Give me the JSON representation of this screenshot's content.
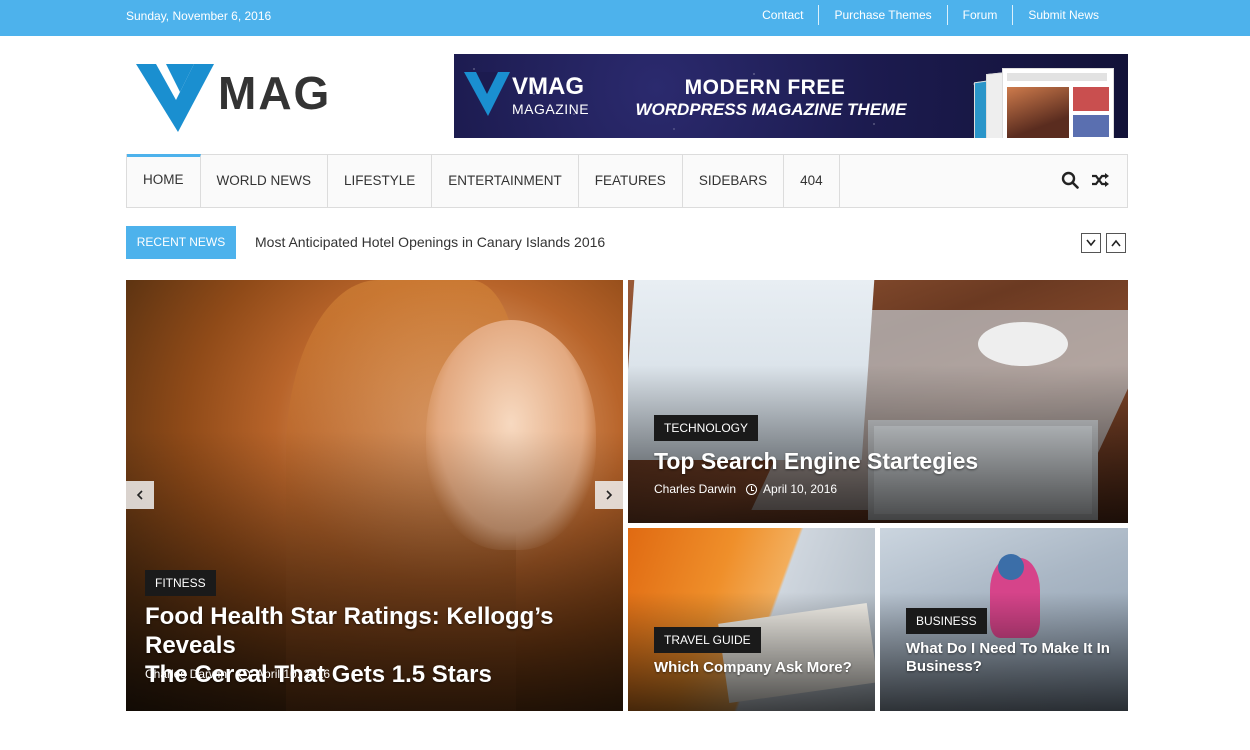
{
  "topbar": {
    "date": "Sunday, November 6, 2016",
    "links": [
      "Contact",
      "Purchase Themes",
      "Forum",
      "Submit News"
    ],
    "color": "#4db2ec"
  },
  "header": {
    "logo_text": "MAG",
    "banner": {
      "brand": "VMAG",
      "brand_sub": "MAGAZINE",
      "line1": "MODERN FREE",
      "line2": "WORDPRESS MAGAZINE THEME"
    }
  },
  "nav": {
    "items": [
      "HOME",
      "WORLD NEWS",
      "LIFESTYLE",
      "ENTERTAINMENT",
      "FEATURES",
      "SIDEBARS",
      "404"
    ],
    "active_index": 0,
    "tools": [
      "search-icon",
      "shuffle-icon"
    ]
  },
  "ticker": {
    "label": "RECENT NEWS",
    "headline": "Most Anticipated Hotel Openings in Canary Islands 2016"
  },
  "slider": {
    "category": "FITNESS",
    "title_line1": "Food Health Star Ratings: Kellogg’s Reveals",
    "title_line2": "The Cereal That Gets 1.5 Stars",
    "author": "Charles Darwin",
    "date": "April 10, 2016"
  },
  "featured": [
    {
      "category": "TECHNOLOGY",
      "title": "Top Search Engine Startegies",
      "author": "Charles Darwin",
      "date": "April 10, 2016"
    },
    {
      "category": "TRAVEL GUIDE",
      "title": "Which Company Ask More?"
    },
    {
      "category": "BUSINESS",
      "title_line1": "What Do I Need To Make It In",
      "title_line2": "Business?"
    }
  ]
}
